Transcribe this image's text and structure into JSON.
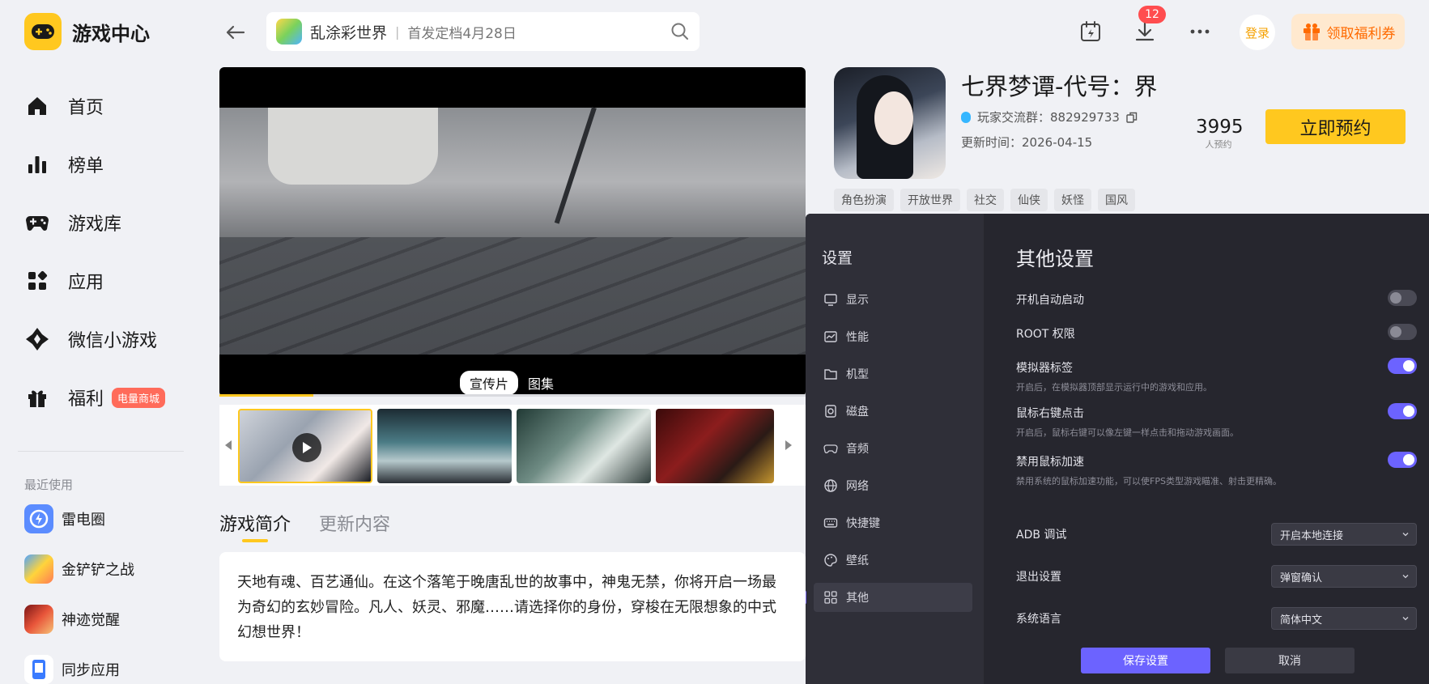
{
  "brand": {
    "title": "游戏中心"
  },
  "nav": {
    "items": [
      {
        "label": "首页",
        "icon": "home-icon"
      },
      {
        "label": "榜单",
        "icon": "ranking-icon"
      },
      {
        "label": "游戏库",
        "icon": "gamepad-icon"
      },
      {
        "label": "应用",
        "icon": "apps-icon"
      },
      {
        "label": "微信小游戏",
        "icon": "mini-game-icon"
      },
      {
        "label": "福利",
        "icon": "gift-icon",
        "badge": "电量商城"
      }
    ]
  },
  "recent": {
    "title": "最近使用",
    "items": [
      {
        "label": "雷电圈"
      },
      {
        "label": "金铲铲之战"
      },
      {
        "label": "神迹觉醒"
      },
      {
        "label": "同步应用"
      }
    ]
  },
  "search": {
    "game_name": "乱涂彩世界",
    "subtitle": "首发定档4月28日"
  },
  "topbar": {
    "download_count": "12",
    "login_label": "登录",
    "coupon_label": "领取福利券"
  },
  "media": {
    "tabs": [
      "宣传片",
      "图集"
    ],
    "active_tab": "宣传片",
    "progress_fraction": 0.16
  },
  "intro": {
    "tabs": [
      "游戏简介",
      "更新内容"
    ],
    "text": "天地有魂、百艺通仙。在这个落笔于晚唐乱世的故事中，神鬼无禁，你将开启一场最为奇幻的玄妙冒险。凡人、妖灵、邪魔……请选择你的身份，穿梭在无限想象的中式幻想世界！"
  },
  "game": {
    "title": "七界梦谭-代号：界",
    "qq_group_label": "玩家交流群：",
    "qq_group_number": "882929733",
    "update_label": "更新时间：",
    "update_date": "2026-04-15",
    "reservation_count": "3995",
    "reservation_label": "人预约",
    "reserve_button": "立即预约",
    "tags": [
      "角色扮演",
      "开放世界",
      "社交",
      "仙侠",
      "妖怪",
      "国风"
    ]
  },
  "settings": {
    "title": "设置",
    "heading": "其他设置",
    "menu": [
      {
        "label": "显示",
        "icon": "monitor-icon"
      },
      {
        "label": "性能",
        "icon": "performance-icon"
      },
      {
        "label": "机型",
        "icon": "device-icon"
      },
      {
        "label": "磁盘",
        "icon": "disk-icon"
      },
      {
        "label": "音频",
        "icon": "audio-icon"
      },
      {
        "label": "网络",
        "icon": "network-icon"
      },
      {
        "label": "快捷键",
        "icon": "keyboard-icon"
      },
      {
        "label": "壁纸",
        "icon": "wallpaper-icon"
      },
      {
        "label": "其他",
        "icon": "grid-icon"
      }
    ],
    "active_menu": "其他",
    "toggles": [
      {
        "label": "开机自动启动",
        "desc": "",
        "on": false
      },
      {
        "label": "ROOT 权限",
        "desc": "",
        "on": false
      },
      {
        "label": "模拟器标签",
        "desc": "开启后，在模拟器顶部显示运行中的游戏和应用。",
        "on": true
      },
      {
        "label": "鼠标右键点击",
        "desc": "开启后，鼠标右键可以像左键一样点击和拖动游戏画面。",
        "on": true
      },
      {
        "label": "禁用鼠标加速",
        "desc": "禁用系统的鼠标加速功能，可以使FPS类型游戏瞄准、射击更精确。",
        "on": true
      }
    ],
    "selects": [
      {
        "label": "ADB 调试",
        "value": "开启本地连接"
      },
      {
        "label": "退出设置",
        "value": "弹窗确认"
      },
      {
        "label": "系统语言",
        "value": "简体中文"
      }
    ],
    "save_label": "保存设置",
    "cancel_label": "取消"
  },
  "colors": {
    "accent_yellow": "#ffc81f",
    "accent_purple": "#6c63ff",
    "badge_red": "#ff4d4f"
  }
}
